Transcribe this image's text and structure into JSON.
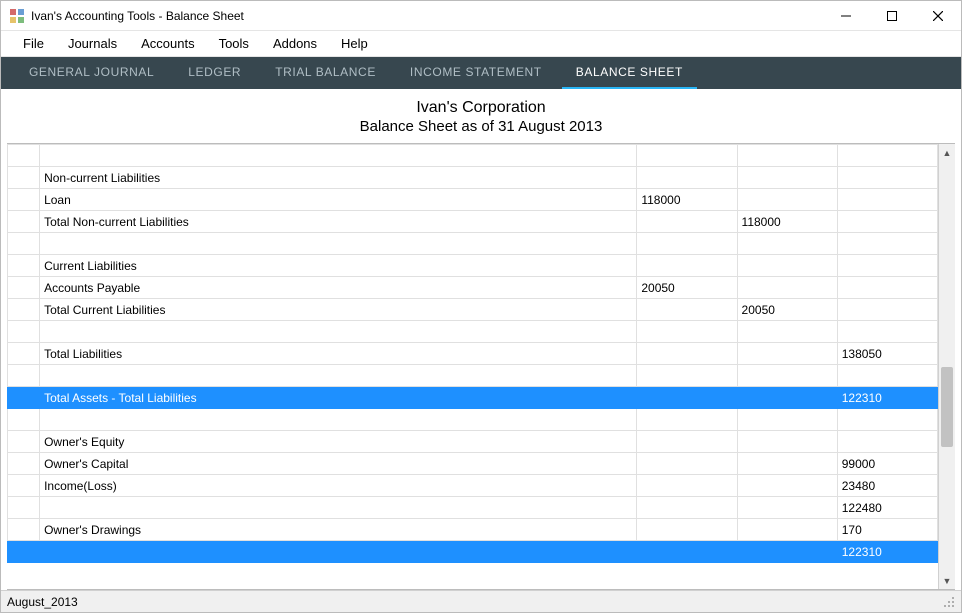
{
  "window": {
    "title": "Ivan's Accounting Tools - Balance Sheet"
  },
  "menu": {
    "items": [
      "File",
      "Journals",
      "Accounts",
      "Tools",
      "Addons",
      "Help"
    ]
  },
  "tabs": {
    "items": [
      {
        "label": "GENERAL JOURNAL",
        "active": false
      },
      {
        "label": "LEDGER",
        "active": false
      },
      {
        "label": "TRIAL BALANCE",
        "active": false
      },
      {
        "label": "INCOME STATEMENT",
        "active": false
      },
      {
        "label": "BALANCE SHEET",
        "active": true
      }
    ]
  },
  "header": {
    "company": "Ivan's Corporation",
    "subtitle": "Balance Sheet as of 31 August 2013"
  },
  "rows": [
    {
      "label": "",
      "a": "",
      "b": "",
      "c": "",
      "hl": false
    },
    {
      "label": "Non-current Liabilities",
      "a": "",
      "b": "",
      "c": "",
      "hl": false
    },
    {
      "label": "Loan",
      "a": "118000",
      "b": "",
      "c": "",
      "hl": false
    },
    {
      "label": "Total Non-current Liabilities",
      "a": "",
      "b": "118000",
      "c": "",
      "hl": false
    },
    {
      "label": "",
      "a": "",
      "b": "",
      "c": "",
      "hl": false
    },
    {
      "label": "Current Liabilities",
      "a": "",
      "b": "",
      "c": "",
      "hl": false
    },
    {
      "label": "Accounts Payable",
      "a": "20050",
      "b": "",
      "c": "",
      "hl": false
    },
    {
      "label": "Total Current Liabilities",
      "a": "",
      "b": "20050",
      "c": "",
      "hl": false
    },
    {
      "label": "",
      "a": "",
      "b": "",
      "c": "",
      "hl": false
    },
    {
      "label": "Total Liabilities",
      "a": "",
      "b": "",
      "c": "138050",
      "hl": false
    },
    {
      "label": "",
      "a": "",
      "b": "",
      "c": "",
      "hl": false
    },
    {
      "label": "Total Assets - Total Liabilities",
      "a": "",
      "b": "",
      "c": "122310",
      "hl": true
    },
    {
      "label": "",
      "a": "",
      "b": "",
      "c": "",
      "hl": false
    },
    {
      "label": "Owner's Equity",
      "a": "",
      "b": "",
      "c": "",
      "hl": false
    },
    {
      "label": "Owner's Capital",
      "a": "",
      "b": "",
      "c": "99000",
      "hl": false
    },
    {
      "label": "Income(Loss)",
      "a": "",
      "b": "",
      "c": "23480",
      "hl": false
    },
    {
      "label": "",
      "a": "",
      "b": "",
      "c": "122480",
      "hl": false
    },
    {
      "label": "Owner's Drawings",
      "a": "",
      "b": "",
      "c": "170",
      "hl": false
    },
    {
      "label": "",
      "a": "",
      "b": "",
      "c": "122310",
      "hl": true
    }
  ],
  "status": {
    "text": "August_2013"
  }
}
